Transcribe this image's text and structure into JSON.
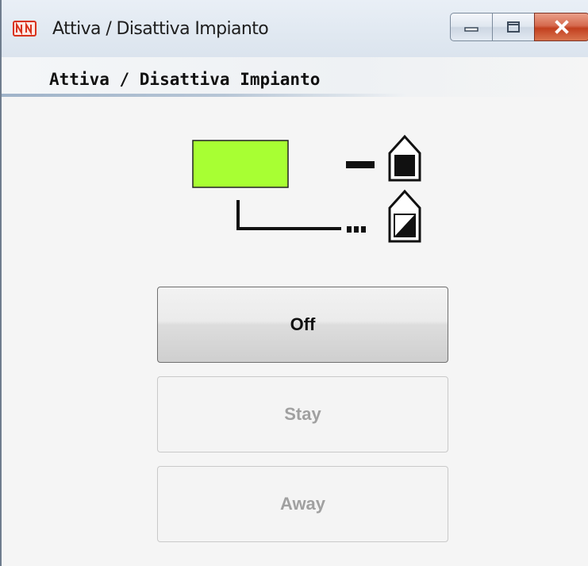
{
  "window": {
    "title": "Attiva / Disattiva Impianto",
    "icon": "nn-app-icon",
    "controls": [
      "minimize-icon",
      "maximize-icon",
      "close-icon"
    ]
  },
  "header": {
    "title": "Attiva / Disattiva Impianto"
  },
  "status": {
    "indicator_color": "#a8ff33",
    "icons": [
      "house-armed-full-icon",
      "house-armed-partial-icon"
    ]
  },
  "buttons": {
    "off": "Off",
    "stay": "Stay",
    "away": "Away"
  },
  "colors": {
    "close_button": "#c2401f",
    "indicator": "#a8ff33"
  }
}
